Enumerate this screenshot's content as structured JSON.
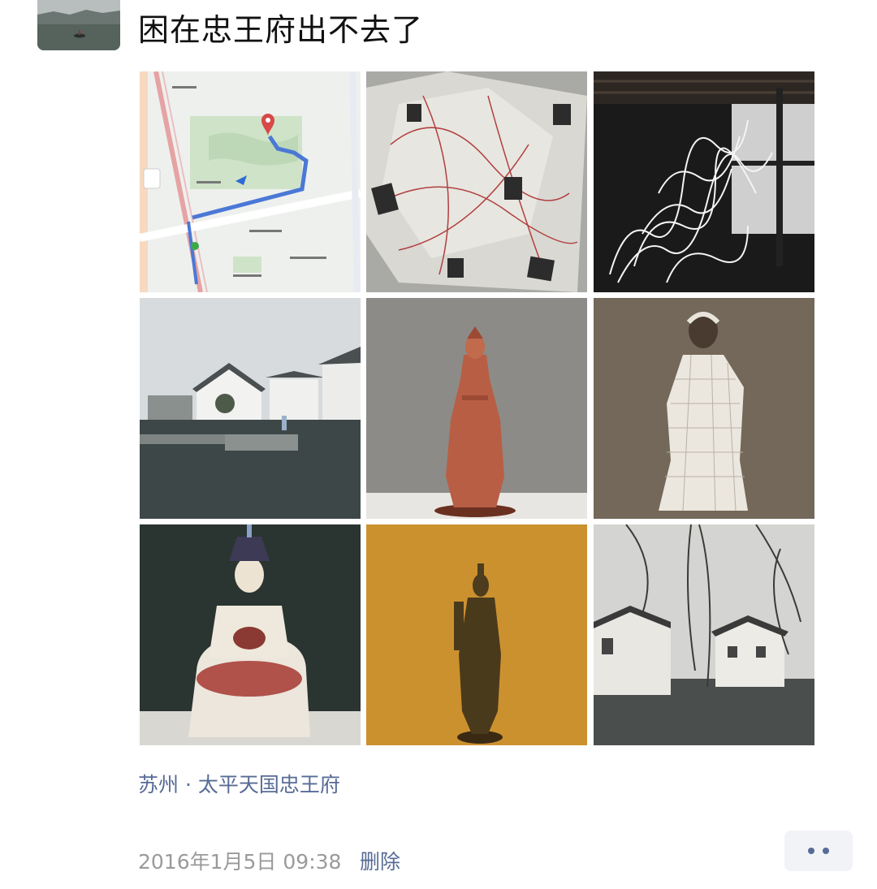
{
  "post": {
    "text": "困在忠王府出不去了",
    "location": "苏州 · 太平天国忠王府",
    "timestamp": "2016年1月5日 09:38",
    "delete_label": "删除"
  },
  "photos": [
    {
      "id": "map",
      "icon": "map-photo"
    },
    {
      "id": "paper-installation",
      "icon": "paper-installation-photo"
    },
    {
      "id": "light-installation",
      "icon": "light-installation-photo"
    },
    {
      "id": "museum-pond",
      "icon": "museum-pond-photo"
    },
    {
      "id": "guanyin-red",
      "icon": "statue-photo"
    },
    {
      "id": "white-figure",
      "icon": "statue-photo"
    },
    {
      "id": "seated-guanyin",
      "icon": "statue-photo"
    },
    {
      "id": "bronze-figure",
      "icon": "statue-photo"
    },
    {
      "id": "canal-houses",
      "icon": "canal-photo"
    }
  ],
  "colors": {
    "link": "#576b95",
    "timestamp": "#9a9a9a",
    "more_bg": "#f2f3f7"
  }
}
